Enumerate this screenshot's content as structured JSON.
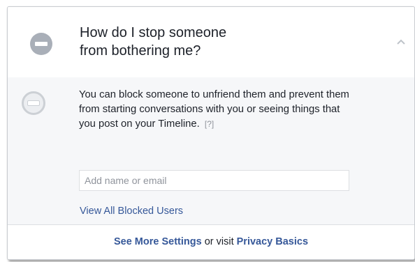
{
  "header": {
    "title_line1": "How do I stop someone",
    "title_line2": "from bothering me?"
  },
  "body": {
    "description": "You can block someone to unfriend them and prevent them from starting conversations with you or seeing things that you post on your Timeline.",
    "help_link": "[?]",
    "input_placeholder": "Add name or email",
    "input_value": "",
    "blocked_users_link": "View All Blocked Users"
  },
  "footer": {
    "settings_link": "See More Settings",
    "connector": "or visit",
    "privacy_link": "Privacy Basics"
  },
  "icons": {
    "header_icon": "block-icon",
    "body_icon": "block-icon",
    "collapse_icon": "chevron-up-icon"
  },
  "colors": {
    "link": "#365899",
    "text": "#1d2129",
    "muted": "#90949c",
    "section_bg": "#f6f7f9",
    "icon_gray": "#a9afb8"
  }
}
